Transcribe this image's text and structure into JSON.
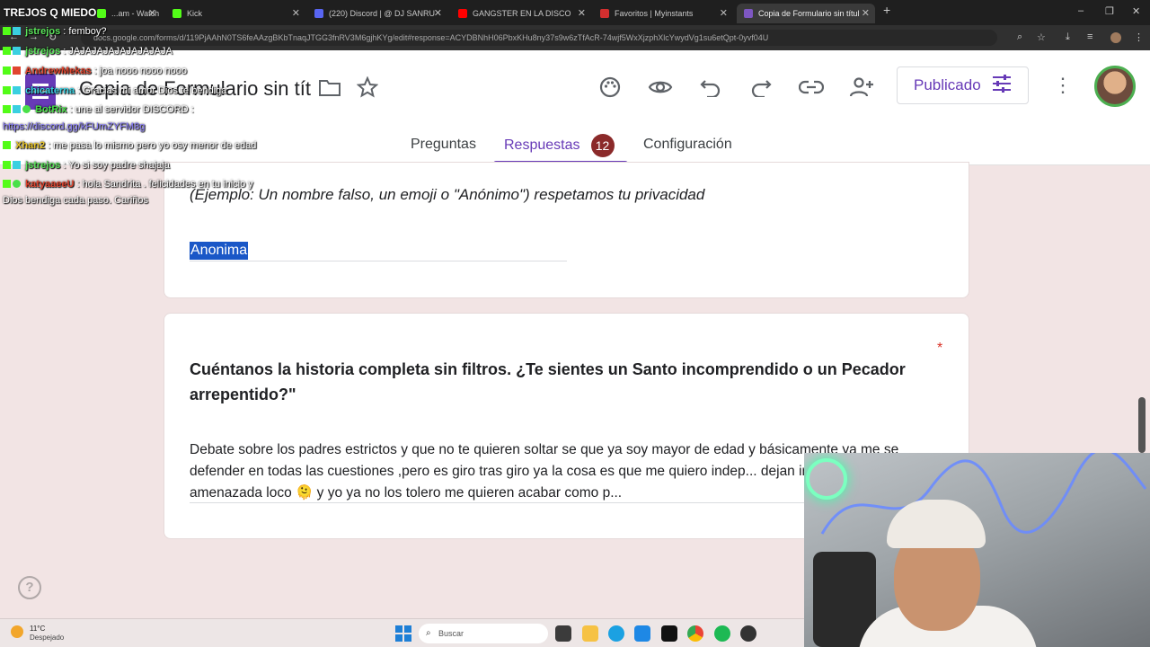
{
  "browser": {
    "tabs": [
      {
        "label": "...am - Watch Live o",
        "favicon_color": "#53fc18",
        "active": false
      },
      {
        "label": "Kick",
        "favicon_color": "#53fc18",
        "active": false
      },
      {
        "label": "(220) Discord | @ DJ SANRU",
        "favicon_color": "#5865f2",
        "active": false
      },
      {
        "label": "GANGSTER EN LA DISCO",
        "favicon_color": "#ff0000",
        "active": false
      },
      {
        "label": "Favoritos | Myinstants",
        "favicon_color": "#d32f2f",
        "active": false
      },
      {
        "label": "Copia de Formulario sin título",
        "favicon_color": "#7e57c2",
        "active": true
      }
    ],
    "url": "docs.google.com/forms/d/119PjAAhN0TS6feAAzgBKbTnaqJTGG3fnRV3M6gjhKYg/edit#response=ACYDBNhH06PbxKHu8ny37s9w6zTfAcR-74wjf5WxXjzphXlcYwydVg1su6etQpt-0yvf04U"
  },
  "form": {
    "title": "Copia de Formulario sin título",
    "publish_label": "Publicado",
    "tabs": {
      "questions": "Preguntas",
      "responses": "Respuestas",
      "settings": "Configuración"
    },
    "responses_count": "12",
    "q1": {
      "description": "(Ejemplo: Un nombre falso, un emoji o \"Anónimo\") respetamos tu privacidad",
      "answer": "Anonima"
    },
    "q2": {
      "title": "Cuéntanos la historia completa sin filtros. ¿Te sientes un Santo incomprendido o un Pecador arrepentido?\"",
      "required_mark": "*",
      "answer": "Debate sobre los padres estrictos y que no te quieren soltar se que ya soy mayor de edad y básicamente ya me se defender en todas las cuestiones ,pero es giro tras giro ya la cosa es que me quiero indep... dejan ir, me tiene como amenazada loco 🫠 y yo ya no los tolero me quieren acabar como p..."
    },
    "help_glyph": "?"
  },
  "stream": {
    "title": "TREJOS Q MIEDO",
    "chat": [
      {
        "user": "jstrejos",
        "user_color": "#5be35b",
        "message": ": femboy?"
      },
      {
        "user": "jstrejos",
        "user_color": "#5be35b",
        "message": ": JAJAJAJAJAJAJAJAJA"
      },
      {
        "user": "AndrewMekas",
        "user_color": "#e0452f",
        "message": ": joa nooo nooo nooo"
      },
      {
        "user": "chicaterna",
        "user_color": "#3ad0e0",
        "message": ": Gracias mi amor Dios te bendiga"
      },
      {
        "user": "BotRix",
        "user_color": "#49e049",
        "message": ": une al servidor DISCORD :"
      },
      {
        "user": "",
        "user_color": "#8a7dff",
        "message": "https://discord.gg/kFUmZYFM8g"
      },
      {
        "user": "Xhan2",
        "user_color": "#e8c62c",
        "message": ": me pasa lo mismo pero yo osy menor de edad"
      },
      {
        "user": "jstrejos",
        "user_color": "#5be35b",
        "message": ": Yo si soy padre shajaja"
      },
      {
        "user": "katyaaeeU",
        "user_color": "#e0452f",
        "message": ": hola Sandrita . felicidades en tu inicio y"
      },
      {
        "user": "",
        "user_color": "#ffffff",
        "message": "Dios bendiga cada paso. Cariños"
      }
    ]
  },
  "taskbar": {
    "weather_temp": "11°C",
    "weather_desc": "Despejado",
    "search_placeholder": "Buscar"
  },
  "icons": [
    "palette-icon",
    "eye-icon",
    "undo-icon",
    "redo-icon",
    "link-icon",
    "add-person-icon",
    "folder-icon",
    "star-icon",
    "tune-icon",
    "more-vert-icon",
    "help-icon"
  ]
}
